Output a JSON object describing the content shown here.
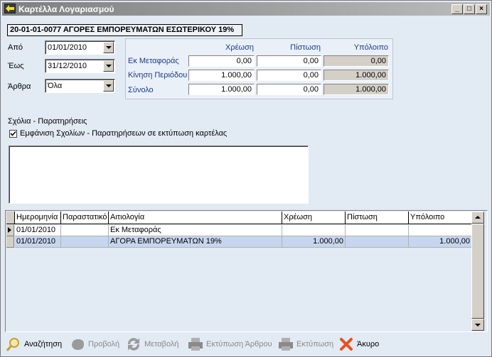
{
  "window": {
    "title": "Καρτέλλα Λογαριασμού"
  },
  "account": {
    "title": "20-01-01-0077 ΑΓΟΡΕΣ ΕΜΠΟΡΕΥΜΑΤΩΝ ΕΣΩΤΕΡΙΚΟΥ 19%"
  },
  "filters": {
    "from_label": "Από",
    "from_value": "01/01/2010",
    "to_label": "Έως",
    "to_value": "31/12/2010",
    "entries_label": "Άρθρα",
    "entries_value": "Όλα"
  },
  "summary": {
    "headers": [
      "Χρέωση",
      "Πίστωση",
      "Υπόλοιπο"
    ],
    "rows": [
      {
        "label": "Εκ Μεταφοράς",
        "values": [
          "0,00",
          "0,00",
          "0,00"
        ]
      },
      {
        "label": "Κίνηση Περιόδου",
        "values": [
          "1.000,00",
          "0,00",
          "1.000,00"
        ]
      },
      {
        "label": "Σύνολο",
        "values": [
          "1.000,00",
          "0,00",
          "1.000,00"
        ]
      }
    ]
  },
  "comments": {
    "section_label": "Σχόλια - Παρατηρήσεις",
    "checkbox_label": "Εμφάνιση Σχολίων - Παρατηρήσεων σε εκτύπωση καρτέλας",
    "checked": true,
    "text": ""
  },
  "grid": {
    "columns": [
      "Ημερομηνία",
      "Παραστατικό",
      "Αιτιολογία",
      "Χρέωση",
      "Πίστωση",
      "Υπόλοιπο"
    ],
    "rows": [
      [
        "01/01/2010",
        "",
        "Εκ Μεταφοράς",
        "",
        "",
        ""
      ],
      [
        "01/01/2010",
        "",
        "ΑΓΟΡΑ ΕΜΠΟΡΕΥΜΑΤΩΝ 19%",
        "1.000,00",
        "",
        "1.000,00"
      ]
    ]
  },
  "toolbar": {
    "search": "Αναζήτηση",
    "view": "Προβολή",
    "edit": "Μεταβολή",
    "print_entry": "Εκτύπωση Άρθρου",
    "print": "Εκτύπωση",
    "cancel": "Άκυρο"
  },
  "colors": {
    "selected_row": "#c6d6ee",
    "label_blue": "#1a3a8a",
    "cancel_icon": "#e8501c"
  }
}
